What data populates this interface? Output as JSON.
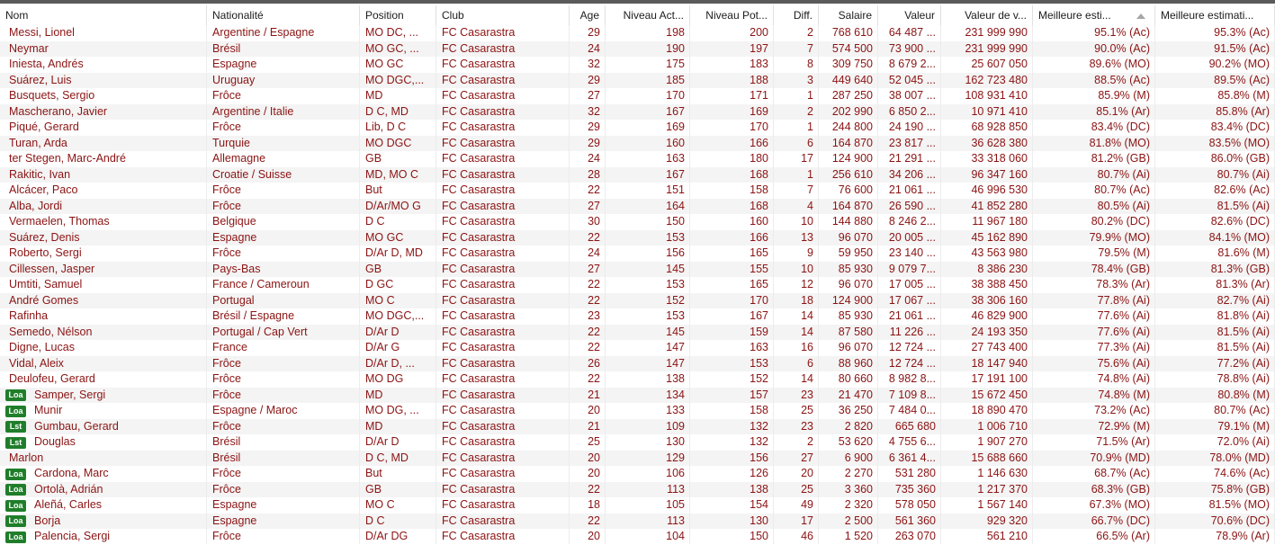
{
  "columns": [
    {
      "key": "name",
      "label": "Nom",
      "align": "l"
    },
    {
      "key": "nationality",
      "label": "Nationalité",
      "align": "l"
    },
    {
      "key": "position",
      "label": "Position",
      "align": "l"
    },
    {
      "key": "club",
      "label": "Club",
      "align": "l"
    },
    {
      "key": "age",
      "label": "Age",
      "align": "r"
    },
    {
      "key": "current_level",
      "label": "Niveau Act...",
      "align": "r"
    },
    {
      "key": "potential_level",
      "label": "Niveau Pot...",
      "align": "r"
    },
    {
      "key": "diff",
      "label": "Diff.",
      "align": "r"
    },
    {
      "key": "salary",
      "label": "Salaire",
      "align": "r"
    },
    {
      "key": "value",
      "label": "Valeur",
      "align": "r"
    },
    {
      "key": "value_v",
      "label": "Valeur de v...",
      "align": "r"
    },
    {
      "key": "best_est",
      "label": "Meilleure esti...",
      "align": "l"
    },
    {
      "key": "best_est2",
      "label": "Meilleure estimati...",
      "align": "l"
    }
  ],
  "sort_icon": "sort-ascending-icon",
  "rows": [
    {
      "badge": "",
      "name": "Messi, Lionel",
      "nationality": "Argentine / Espagne",
      "position": "MO DC, ...",
      "club": "FC Casarastra",
      "age": "29",
      "current_level": "198",
      "potential_level": "200",
      "diff": "2",
      "salary": "768 610",
      "value": "64 487 ...",
      "value_v": "231 999 990",
      "best_est": "95.1% (Ac)",
      "best_est2": "95.3% (Ac)"
    },
    {
      "badge": "",
      "name": "Neymar",
      "nationality": "Brésil",
      "position": "MO GC, ...",
      "club": "FC Casarastra",
      "age": "24",
      "current_level": "190",
      "potential_level": "197",
      "diff": "7",
      "salary": "574 500",
      "value": "73 900 ...",
      "value_v": "231 999 990",
      "best_est": "90.0% (Ac)",
      "best_est2": "91.5% (Ac)"
    },
    {
      "badge": "",
      "name": "Iniesta, Andrés",
      "nationality": "Espagne",
      "position": "MO GC",
      "club": "FC Casarastra",
      "age": "32",
      "current_level": "175",
      "potential_level": "183",
      "diff": "8",
      "salary": "309 750",
      "value": "8 679 2...",
      "value_v": "25 607 050",
      "best_est": "89.6% (MO)",
      "best_est2": "90.2% (MO)"
    },
    {
      "badge": "",
      "name": "Suárez, Luis",
      "nationality": "Uruguay",
      "position": "MO DGC,...",
      "club": "FC Casarastra",
      "age": "29",
      "current_level": "185",
      "potential_level": "188",
      "diff": "3",
      "salary": "449 640",
      "value": "52 045 ...",
      "value_v": "162 723 480",
      "best_est": "88.5% (Ac)",
      "best_est2": "89.5% (Ac)"
    },
    {
      "badge": "",
      "name": "Busquets, Sergio",
      "nationality": "Frôce",
      "position": "MD",
      "club": "FC Casarastra",
      "age": "27",
      "current_level": "170",
      "potential_level": "171",
      "diff": "1",
      "salary": "287 250",
      "value": "38 007 ...",
      "value_v": "108 931 410",
      "best_est": "85.9% (M)",
      "best_est2": "85.8% (M)"
    },
    {
      "badge": "",
      "name": "Mascherano, Javier",
      "nationality": "Argentine / Italie",
      "position": "D C, MD",
      "club": "FC Casarastra",
      "age": "32",
      "current_level": "167",
      "potential_level": "169",
      "diff": "2",
      "salary": "202 990",
      "value": "6 850 2...",
      "value_v": "10 971 410",
      "best_est": "85.1% (Ar)",
      "best_est2": "85.8% (Ar)"
    },
    {
      "badge": "",
      "name": "Piqué, Gerard",
      "nationality": "Frôce",
      "position": "Lib, D C",
      "club": "FC Casarastra",
      "age": "29",
      "current_level": "169",
      "potential_level": "170",
      "diff": "1",
      "salary": "244 800",
      "value": "24 190 ...",
      "value_v": "68 928 850",
      "best_est": "83.4% (DC)",
      "best_est2": "83.4% (DC)"
    },
    {
      "badge": "",
      "name": "Turan, Arda",
      "nationality": "Turquie",
      "position": "MO DGC",
      "club": "FC Casarastra",
      "age": "29",
      "current_level": "160",
      "potential_level": "166",
      "diff": "6",
      "salary": "164 870",
      "value": "23 817 ...",
      "value_v": "36 628 380",
      "best_est": "81.8% (MO)",
      "best_est2": "83.5% (MO)"
    },
    {
      "badge": "",
      "name": "ter Stegen, Marc-André",
      "nationality": "Allemagne",
      "position": "GB",
      "club": "FC Casarastra",
      "age": "24",
      "current_level": "163",
      "potential_level": "180",
      "diff": "17",
      "salary": "124 900",
      "value": "21 291 ...",
      "value_v": "33 318 060",
      "best_est": "81.2% (GB)",
      "best_est2": "86.0% (GB)"
    },
    {
      "badge": "",
      "name": "Rakitic, Ivan",
      "nationality": "Croatie / Suisse",
      "position": "MD, MO C",
      "club": "FC Casarastra",
      "age": "28",
      "current_level": "167",
      "potential_level": "168",
      "diff": "1",
      "salary": "256 610",
      "value": "34 206 ...",
      "value_v": "96 347 160",
      "best_est": "80.7% (Ai)",
      "best_est2": "80.7% (Ai)"
    },
    {
      "badge": "",
      "name": "Alcácer, Paco",
      "nationality": "Frôce",
      "position": "But",
      "club": "FC Casarastra",
      "age": "22",
      "current_level": "151",
      "potential_level": "158",
      "diff": "7",
      "salary": "76 600",
      "value": "21 061 ...",
      "value_v": "46 996 530",
      "best_est": "80.7% (Ac)",
      "best_est2": "82.6% (Ac)"
    },
    {
      "badge": "",
      "name": "Alba, Jordi",
      "nationality": "Frôce",
      "position": "D/Ar/MO G",
      "club": "FC Casarastra",
      "age": "27",
      "current_level": "164",
      "potential_level": "168",
      "diff": "4",
      "salary": "164 870",
      "value": "26 590 ...",
      "value_v": "41 852 280",
      "best_est": "80.5% (Ai)",
      "best_est2": "81.5% (Ai)"
    },
    {
      "badge": "",
      "name": "Vermaelen, Thomas",
      "nationality": "Belgique",
      "position": "D C",
      "club": "FC Casarastra",
      "age": "30",
      "current_level": "150",
      "potential_level": "160",
      "diff": "10",
      "salary": "144 880",
      "value": "8 246 2...",
      "value_v": "11 967 180",
      "best_est": "80.2% (DC)",
      "best_est2": "82.6% (DC)"
    },
    {
      "badge": "",
      "name": "Suárez, Denis",
      "nationality": "Espagne",
      "position": "MO GC",
      "club": "FC Casarastra",
      "age": "22",
      "current_level": "153",
      "potential_level": "166",
      "diff": "13",
      "salary": "96 070",
      "value": "20 005 ...",
      "value_v": "45 162 890",
      "best_est": "79.9% (MO)",
      "best_est2": "84.1% (MO)"
    },
    {
      "badge": "",
      "name": "Roberto, Sergi",
      "nationality": "Frôce",
      "position": "D/Ar D, MD",
      "club": "FC Casarastra",
      "age": "24",
      "current_level": "156",
      "potential_level": "165",
      "diff": "9",
      "salary": "59 950",
      "value": "23 140 ...",
      "value_v": "43 563 980",
      "best_est": "79.5% (M)",
      "best_est2": "81.6% (M)"
    },
    {
      "badge": "",
      "name": "Cillessen, Jasper",
      "nationality": "Pays-Bas",
      "position": "GB",
      "club": "FC Casarastra",
      "age": "27",
      "current_level": "145",
      "potential_level": "155",
      "diff": "10",
      "salary": "85 930",
      "value": "9 079 7...",
      "value_v": "8 386 230",
      "best_est": "78.4% (GB)",
      "best_est2": "81.3% (GB)"
    },
    {
      "badge": "",
      "name": "Umtiti, Samuel",
      "nationality": "France / Cameroun",
      "position": "D GC",
      "club": "FC Casarastra",
      "age": "22",
      "current_level": "153",
      "potential_level": "165",
      "diff": "12",
      "salary": "96 070",
      "value": "17 005 ...",
      "value_v": "38 388 450",
      "best_est": "78.3% (Ar)",
      "best_est2": "81.3% (Ar)"
    },
    {
      "badge": "",
      "name": "André Gomes",
      "nationality": "Portugal",
      "position": "MO C",
      "club": "FC Casarastra",
      "age": "22",
      "current_level": "152",
      "potential_level": "170",
      "diff": "18",
      "salary": "124 900",
      "value": "17 067 ...",
      "value_v": "38 306 160",
      "best_est": "77.8% (Ai)",
      "best_est2": "82.7% (Ai)"
    },
    {
      "badge": "",
      "name": "Rafinha",
      "nationality": "Brésil / Espagne",
      "position": "MO DGC,...",
      "club": "FC Casarastra",
      "age": "23",
      "current_level": "153",
      "potential_level": "167",
      "diff": "14",
      "salary": "85 930",
      "value": "21 061 ...",
      "value_v": "46 829 900",
      "best_est": "77.6% (Ai)",
      "best_est2": "81.8% (Ai)"
    },
    {
      "badge": "",
      "name": "Semedo, Nélson",
      "nationality": "Portugal / Cap Vert",
      "position": "D/Ar D",
      "club": "FC Casarastra",
      "age": "22",
      "current_level": "145",
      "potential_level": "159",
      "diff": "14",
      "salary": "87 580",
      "value": "11 226 ...",
      "value_v": "24 193 350",
      "best_est": "77.6% (Ai)",
      "best_est2": "81.5% (Ai)"
    },
    {
      "badge": "",
      "name": "Digne, Lucas",
      "nationality": "France",
      "position": "D/Ar G",
      "club": "FC Casarastra",
      "age": "22",
      "current_level": "147",
      "potential_level": "163",
      "diff": "16",
      "salary": "96 070",
      "value": "12 724 ...",
      "value_v": "27 743 400",
      "best_est": "77.3% (Ai)",
      "best_est2": "81.5% (Ai)"
    },
    {
      "badge": "",
      "name": "Vidal, Aleix",
      "nationality": "Frôce",
      "position": "D/Ar D, ...",
      "club": "FC Casarastra",
      "age": "26",
      "current_level": "147",
      "potential_level": "153",
      "diff": "6",
      "salary": "88 960",
      "value": "12 724 ...",
      "value_v": "18 147 940",
      "best_est": "75.6% (Ai)",
      "best_est2": "77.2% (Ai)"
    },
    {
      "badge": "",
      "name": "Deulofeu, Gerard",
      "nationality": "Frôce",
      "position": "MO DG",
      "club": "FC Casarastra",
      "age": "22",
      "current_level": "138",
      "potential_level": "152",
      "diff": "14",
      "salary": "80 660",
      "value": "8 982 8...",
      "value_v": "17 191 100",
      "best_est": "74.8% (Ai)",
      "best_est2": "78.8% (Ai)"
    },
    {
      "badge": "Loa",
      "name": "Samper, Sergi",
      "nationality": "Frôce",
      "position": "MD",
      "club": "FC Casarastra",
      "age": "21",
      "current_level": "134",
      "potential_level": "157",
      "diff": "23",
      "salary": "21 470",
      "value": "7 109 8...",
      "value_v": "15 672 450",
      "best_est": "74.8% (M)",
      "best_est2": "80.8% (M)"
    },
    {
      "badge": "Loa",
      "name": "Munir",
      "nationality": "Espagne / Maroc",
      "position": "MO DG, ...",
      "club": "FC Casarastra",
      "age": "20",
      "current_level": "133",
      "potential_level": "158",
      "diff": "25",
      "salary": "36 250",
      "value": "7 484 0...",
      "value_v": "18 890 470",
      "best_est": "73.2% (Ac)",
      "best_est2": "80.7% (Ac)"
    },
    {
      "badge": "Lst",
      "name": "Gumbau, Gerard",
      "nationality": "Frôce",
      "position": "MD",
      "club": "FC Casarastra",
      "age": "21",
      "current_level": "109",
      "potential_level": "132",
      "diff": "23",
      "salary": "2 820",
      "value": "665 680",
      "value_v": "1 006 710",
      "best_est": "72.9% (M)",
      "best_est2": "79.1% (M)"
    },
    {
      "badge": "Lst",
      "name": "Douglas",
      "nationality": "Brésil",
      "position": "D/Ar D",
      "club": "FC Casarastra",
      "age": "25",
      "current_level": "130",
      "potential_level": "132",
      "diff": "2",
      "salary": "53 620",
      "value": "4 755 6...",
      "value_v": "1 907 270",
      "best_est": "71.5% (Ar)",
      "best_est2": "72.0% (Ai)"
    },
    {
      "badge": "",
      "name": "Marlon",
      "nationality": "Brésil",
      "position": "D C, MD",
      "club": "FC Casarastra",
      "age": "20",
      "current_level": "129",
      "potential_level": "156",
      "diff": "27",
      "salary": "6 900",
      "value": "6 361 4...",
      "value_v": "15 688 660",
      "best_est": "70.9% (MD)",
      "best_est2": "78.0% (MD)"
    },
    {
      "badge": "Loa",
      "name": "Cardona, Marc",
      "nationality": "Frôce",
      "position": "But",
      "club": "FC Casarastra",
      "age": "20",
      "current_level": "106",
      "potential_level": "126",
      "diff": "20",
      "salary": "2 270",
      "value": "531 280",
      "value_v": "1 146 630",
      "best_est": "68.7% (Ac)",
      "best_est2": "74.6% (Ac)"
    },
    {
      "badge": "Loa",
      "name": "Ortolà, Adrián",
      "nationality": "Frôce",
      "position": "GB",
      "club": "FC Casarastra",
      "age": "22",
      "current_level": "113",
      "potential_level": "138",
      "diff": "25",
      "salary": "3 360",
      "value": "735 360",
      "value_v": "1 217 370",
      "best_est": "68.3% (GB)",
      "best_est2": "75.8% (GB)"
    },
    {
      "badge": "Loa",
      "name": "Aleñá, Carles",
      "nationality": "Espagne",
      "position": "MO C",
      "club": "FC Casarastra",
      "age": "18",
      "current_level": "105",
      "potential_level": "154",
      "diff": "49",
      "salary": "2 320",
      "value": "578 050",
      "value_v": "1 567 140",
      "best_est": "67.3% (MO)",
      "best_est2": "81.5% (MO)"
    },
    {
      "badge": "Loa",
      "name": "Borja",
      "nationality": "Espagne",
      "position": "D C",
      "club": "FC Casarastra",
      "age": "22",
      "current_level": "113",
      "potential_level": "130",
      "diff": "17",
      "salary": "2 500",
      "value": "561 360",
      "value_v": "929 320",
      "best_est": "66.7% (DC)",
      "best_est2": "70.6% (DC)"
    },
    {
      "badge": "Loa",
      "name": "Palencia, Sergi",
      "nationality": "Frôce",
      "position": "D/Ar DG",
      "club": "FC Casarastra",
      "age": "20",
      "current_level": "104",
      "potential_level": "150",
      "diff": "46",
      "salary": "1 520",
      "value": "263 070",
      "value_v": "561 210",
      "best_est": "66.5% (Ar)",
      "best_est2": "78.9% (Ar)"
    }
  ]
}
